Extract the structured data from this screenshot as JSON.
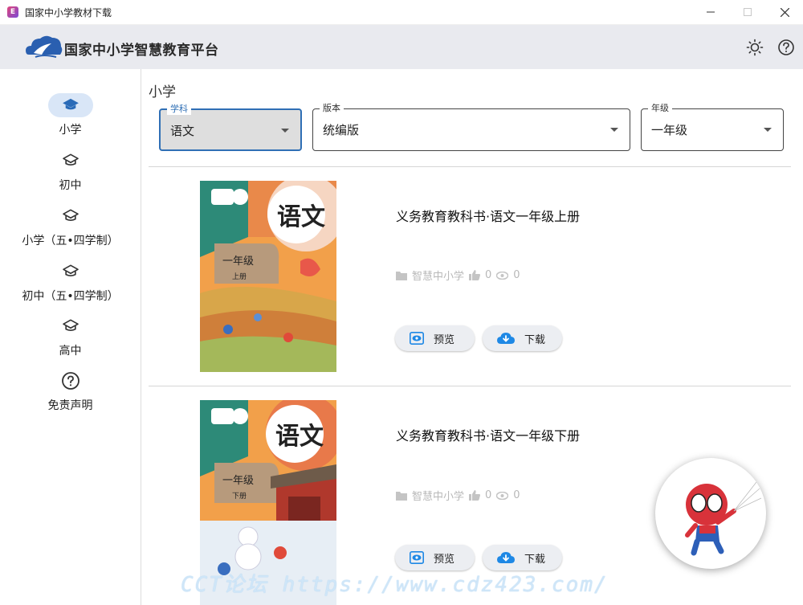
{
  "window": {
    "title": "国家中小学教材下载",
    "app_icon_letter": "E"
  },
  "header": {
    "brand": "国家中小学智慧教育平台"
  },
  "sidebar": {
    "items": [
      {
        "label": "小学",
        "icon": "graduation-cap-icon",
        "active": true
      },
      {
        "label": "初中",
        "icon": "graduation-cap-icon",
        "active": false
      },
      {
        "label": "小学（五•四学制）",
        "icon": "graduation-cap-icon",
        "active": false
      },
      {
        "label": "初中（五•四学制）",
        "icon": "graduation-cap-icon",
        "active": false
      },
      {
        "label": "高中",
        "icon": "graduation-cap-icon",
        "active": false
      },
      {
        "label": "免责声明",
        "icon": "help-circle-icon",
        "active": false
      }
    ]
  },
  "main": {
    "section_title": "小学",
    "filters": {
      "subject": {
        "legend": "学科",
        "value": "语文"
      },
      "edition": {
        "legend": "版本",
        "value": "统编版"
      },
      "grade": {
        "legend": "年级",
        "value": "一年级"
      }
    },
    "books": [
      {
        "title": "义务教育教科书·语文一年级上册",
        "publisher": "智慧中小学",
        "likes": "0",
        "views": "0",
        "preview_label": "预览",
        "download_label": "下载",
        "cover": {
          "title": "语文",
          "grade": "一年级",
          "volume": "上册"
        }
      },
      {
        "title": "义务教育教科书·语文一年级下册",
        "publisher": "智慧中小学",
        "likes": "0",
        "views": "0",
        "preview_label": "预览",
        "download_label": "下载",
        "cover": {
          "title": "语文",
          "grade": "一年级",
          "volume": "下册"
        }
      }
    ]
  },
  "watermark": "CCT论坛 https://www.cdz423.com/",
  "colors": {
    "accent": "#2f6fb5",
    "active_nav": "#d9e6f7",
    "header_bg": "#e9eaef",
    "download_icon": "#1e88e5"
  }
}
